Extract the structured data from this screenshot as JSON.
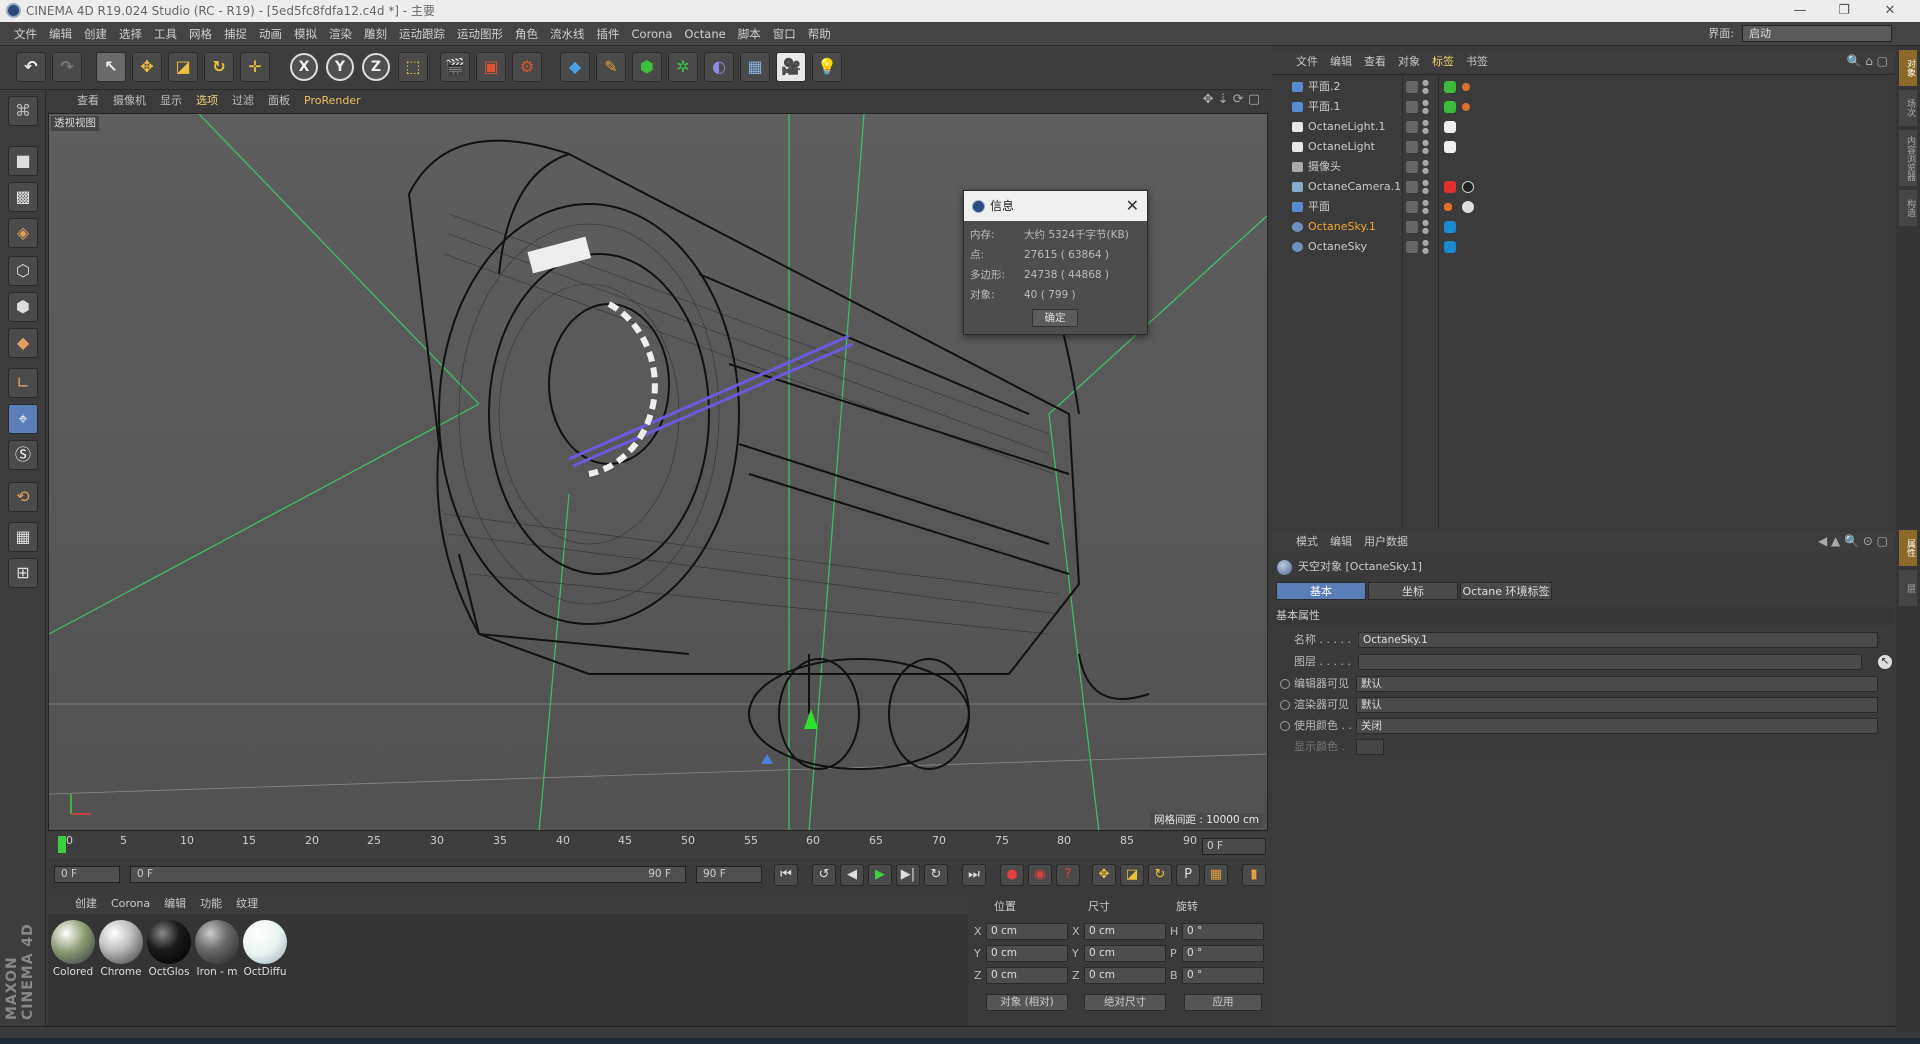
{
  "window": {
    "title": "CINEMA 4D R19.024 Studio (RC - R19) - [5ed5fc8fdfa12.c4d *] - 主要"
  },
  "menu": [
    "文件",
    "编辑",
    "创建",
    "选择",
    "工具",
    "网格",
    "捕捉",
    "动画",
    "模拟",
    "渲染",
    "雕刻",
    "运动跟踪",
    "运动图形",
    "角色",
    "流水线",
    "插件",
    "Corona",
    "Octane",
    "脚本",
    "窗口",
    "帮助"
  ],
  "layout": {
    "label": "界面:",
    "value": "启动"
  },
  "toolbar": {
    "undo_icon": "undo-icon",
    "redo_icon": "redo-icon",
    "tools": [
      "select-icon",
      "move-icon",
      "scale-icon",
      "rotate-icon",
      "transform-icon"
    ],
    "axes": [
      "X",
      "Y",
      "Z"
    ]
  },
  "viewport": {
    "menu": [
      "查看",
      "摄像机",
      "显示",
      "选项",
      "过滤",
      "面板",
      "ProRender"
    ],
    "label": "透视视图",
    "grid_label": "网格间距 : 10000 cm"
  },
  "dialog": {
    "title": "信息",
    "rows": [
      {
        "key": "内存:",
        "value": "大约 5324千字节(KB)"
      },
      {
        "key": "点:",
        "value": "27615 ( 63864 )"
      },
      {
        "key": "多边形:",
        "value": "24738 ( 44868 )"
      },
      {
        "key": "对象:",
        "value": "40 ( 799 )"
      }
    ],
    "ok": "确定"
  },
  "timeline": {
    "ticks": [
      "0",
      "5",
      "10",
      "15",
      "20",
      "25",
      "30",
      "35",
      "40",
      "45",
      "50",
      "55",
      "60",
      "65",
      "70",
      "75",
      "80",
      "85",
      "90"
    ],
    "frame": "0 F",
    "start": "0 F",
    "range_start": "0 F",
    "range_end": "90 F",
    "end": "90 F"
  },
  "materials": {
    "menu": [
      "创建",
      "Corona",
      "编辑",
      "功能",
      "纹理"
    ],
    "items": [
      {
        "name": "Colored",
        "color": "#8a9a70"
      },
      {
        "name": "Chrome",
        "color": "#c0c0c0"
      },
      {
        "name": "OctGlos",
        "color": "#1a1a1a"
      },
      {
        "name": "Iron - m",
        "color": "#6a6a6a"
      },
      {
        "name": "OctDiffu",
        "color": "#e8f4f0"
      }
    ]
  },
  "coords": {
    "headers": [
      "位置",
      "尺寸",
      "旋转"
    ],
    "pos": [
      {
        "axis": "X",
        "value": "0 cm"
      },
      {
        "axis": "Y",
        "value": "0 cm"
      },
      {
        "axis": "Z",
        "value": "0 cm"
      }
    ],
    "size": [
      {
        "axis": "X",
        "value": "0 cm"
      },
      {
        "axis": "Y",
        "value": "0 cm"
      },
      {
        "axis": "Z",
        "value": "0 cm"
      }
    ],
    "rot": [
      {
        "axis": "H",
        "value": "0 °"
      },
      {
        "axis": "P",
        "value": "0 °"
      },
      {
        "axis": "B",
        "value": "0 °"
      }
    ],
    "mode1": "对象 (相对)",
    "mode2": "绝对尺寸",
    "apply": "应用"
  },
  "object_manager": {
    "menu": [
      "文件",
      "编辑",
      "查看",
      "对象",
      "标签",
      "书签"
    ],
    "objects": [
      {
        "name": "平面.2",
        "icon": "#5a8ad0",
        "highlight": false,
        "tag": "#3cba3c"
      },
      {
        "name": "平面.1",
        "icon": "#5a8ad0",
        "highlight": false,
        "tag": "#3cba3c"
      },
      {
        "name": "OctaneLight.1",
        "icon": "#e8e8e8",
        "highlight": false,
        "tag": "#f0f0f0"
      },
      {
        "name": "OctaneLight",
        "icon": "#e8e8e8",
        "highlight": false,
        "tag": "#f0f0f0"
      },
      {
        "name": "摄像头",
        "icon": "#aaaaaa",
        "highlight": false,
        "tag": ""
      },
      {
        "name": "OctaneCamera.1",
        "icon": "#88aacc",
        "highlight": false,
        "tag": "#e03030"
      },
      {
        "name": "平面",
        "icon": "#5a8ad0",
        "highlight": false,
        "tag": "#cccccc"
      },
      {
        "name": "OctaneSky.1",
        "icon": "#7090c0",
        "highlight": true,
        "tag": "#1a8ad0"
      },
      {
        "name": "OctaneSky",
        "icon": "#7090c0",
        "highlight": false,
        "tag": "#1a8ad0"
      }
    ]
  },
  "attribute_manager": {
    "menu": [
      "模式",
      "编辑",
      "用户数据"
    ],
    "title": "天空对象 [OctaneSky.1]",
    "tabs": [
      "基本",
      "坐标",
      "Octane 环境标签"
    ],
    "section": "基本属性",
    "rows": [
      {
        "label": "名称 . . . . .",
        "value": "OctaneSky.1"
      },
      {
        "label": "图层 . . . . .",
        "value": ""
      },
      {
        "label": "编辑器可见",
        "value": "默认"
      },
      {
        "label": "渲染器可见",
        "value": "默认"
      },
      {
        "label": "使用颜色 . .",
        "value": "关闭"
      },
      {
        "label": "显示颜色 .",
        "value": ""
      }
    ]
  },
  "brand": "MAXON CINEMA 4D",
  "colors": {
    "accent": "#f0c060",
    "selected_tab": "#5a7eb8",
    "playhead": "#3bd13b"
  }
}
